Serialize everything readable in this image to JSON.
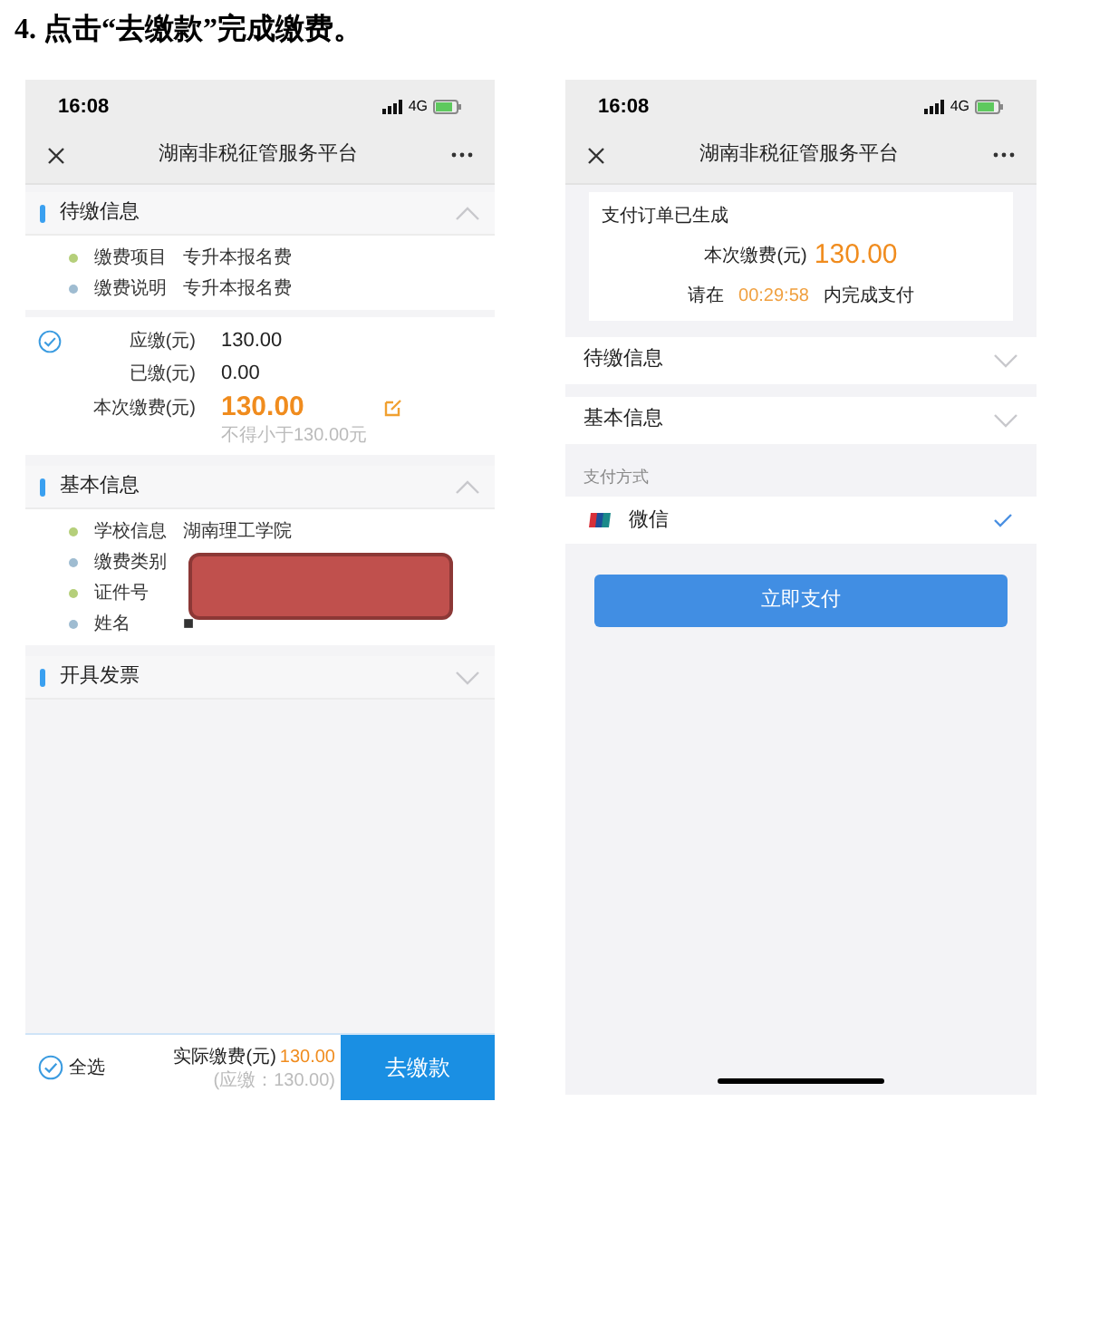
{
  "heading": "4. 点击“去缴款”完成缴费。",
  "left_screen": {
    "status_bar": {
      "time": "16:08",
      "network": "4G"
    },
    "nav": {
      "title": "湖南非税征管服务平台"
    },
    "sections": [
      {
        "title": "待缴信息",
        "expanded": true,
        "items": [
          {
            "label": "缴费项目",
            "value": "专升本报名费",
            "color": "#b5cf7a"
          },
          {
            "label": "缴费说明",
            "value": "专升本报名费",
            "color": "#9fbcd1"
          }
        ],
        "amounts": {
          "checked": true,
          "rows": [
            {
              "label": "应缴(元)",
              "value": "130.00"
            },
            {
              "label": "已缴(元)",
              "value": "0.00"
            }
          ],
          "current": {
            "label": "本次缴费(元)",
            "value": "130.00",
            "hint": "不得小于130.00元"
          }
        }
      },
      {
        "title": "基本信息",
        "expanded": true,
        "redacted": true,
        "items": [
          {
            "label": "学校信息",
            "value": "湖南理工学院",
            "color": "#b5cf7a"
          },
          {
            "label": "缴费类别",
            "color": "#9fbcd1"
          },
          {
            "label": "证件号",
            "color": "#b5cf7a"
          },
          {
            "label": "姓名",
            "value": "■",
            "color": "#9fbcd1"
          }
        ]
      },
      {
        "title": "开具发票",
        "expanded": false
      }
    ],
    "bottom_bar": {
      "select_all": {
        "label": "全选",
        "checked": true
      },
      "total_label": "实际缴费(元)",
      "total_value": "130.00",
      "due_note": "(应缴：130.00)",
      "pay_button": "去缴款"
    }
  },
  "right_screen": {
    "status_bar": {
      "time": "16:08",
      "network": "4G"
    },
    "nav": {
      "title": "湖南非税征管服务平台"
    },
    "order_card": {
      "title": "支付订单已生成",
      "amount_label": "本次缴费(元)",
      "amount_value": "130.00",
      "countdown_prefix": "请在",
      "countdown": "00:29:58",
      "countdown_suffix": "内完成支付"
    },
    "sections": [
      {
        "title": "待缴信息",
        "expanded": false
      },
      {
        "title": "基本信息",
        "expanded": false
      }
    ],
    "payment_label": "支付方式",
    "methods": [
      {
        "name": "微信",
        "selected": true
      }
    ],
    "pay_button": "立即支付"
  }
}
